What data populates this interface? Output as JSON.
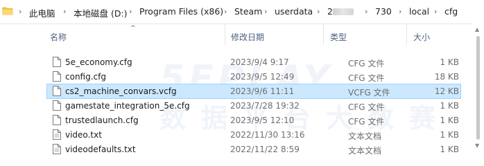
{
  "address_bar": {
    "crumbs": [
      "此电脑",
      "本地磁盘 (D:)",
      "Program Files (x86)",
      "Steam",
      "userdata",
      "2",
      "730",
      "local",
      "cfg"
    ]
  },
  "columns": {
    "name": "名称",
    "date": "修改日期",
    "type": "类型",
    "size": "大小"
  },
  "files": [
    {
      "name": "5e_economy.cfg",
      "date": "2023/9/4 9:17",
      "type": "CFG 文件",
      "size": "1 KB"
    },
    {
      "name": "config.cfg",
      "date": "2023/9/5 12:49",
      "type": "CFG 文件",
      "size": "18 KB"
    },
    {
      "name": "cs2_machine_convars.vcfg",
      "date": "2023/9/6 11:11",
      "type": "VCFG 文件",
      "size": "12 KB",
      "selected": true
    },
    {
      "name": "gamestate_integration_5e.cfg",
      "date": "2023/7/28 19:32",
      "type": "CFG 文件",
      "size": "1 KB"
    },
    {
      "name": "trustedlaunch.cfg",
      "date": "2023/9/5 12:10",
      "type": "CFG 文件",
      "size": "1 KB"
    },
    {
      "name": "video.txt",
      "date": "2022/11/30 13:16",
      "type": "文本文档",
      "size": "1 KB"
    },
    {
      "name": "videodefaults.txt",
      "date": "2022/11/22 8:59",
      "type": "文本文档",
      "size": "1 KB"
    }
  ],
  "watermark": {
    "line1": "5EPLAY",
    "line2": "数据平台大数赛"
  },
  "colors": {
    "selection_bg": "#cce8ff",
    "selection_border": "#99d1ff",
    "folder": "#f2c94c",
    "header_text": "#4d6082"
  }
}
